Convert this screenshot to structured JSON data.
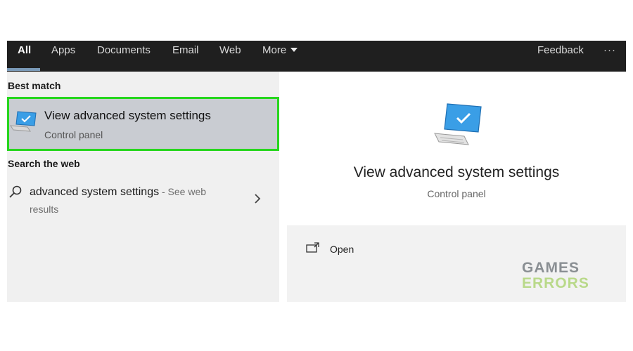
{
  "tabs": {
    "all": "All",
    "apps": "Apps",
    "documents": "Documents",
    "email": "Email",
    "web": "Web",
    "more": "More",
    "feedback": "Feedback",
    "overflow": "···"
  },
  "left": {
    "best_match_label": "Best match",
    "best_match": {
      "title": "View advanced system settings",
      "subtitle": "Control panel",
      "icon": "monitor-icon"
    },
    "search_web_label": "Search the web",
    "web_result": {
      "query": "advanced system settings",
      "suffix": " - See web results",
      "icon": "search-icon"
    }
  },
  "right": {
    "title": "View advanced system settings",
    "subtitle": "Control panel",
    "open_label": "Open"
  },
  "watermark": {
    "line1": "GAMES",
    "line2": "ERRORS"
  },
  "colors": {
    "topbar": "#1f1f1f",
    "highlight_border": "#27d61e",
    "selected_bg": "#c9ccd2",
    "monitor_blue": "#3a9ee6"
  }
}
